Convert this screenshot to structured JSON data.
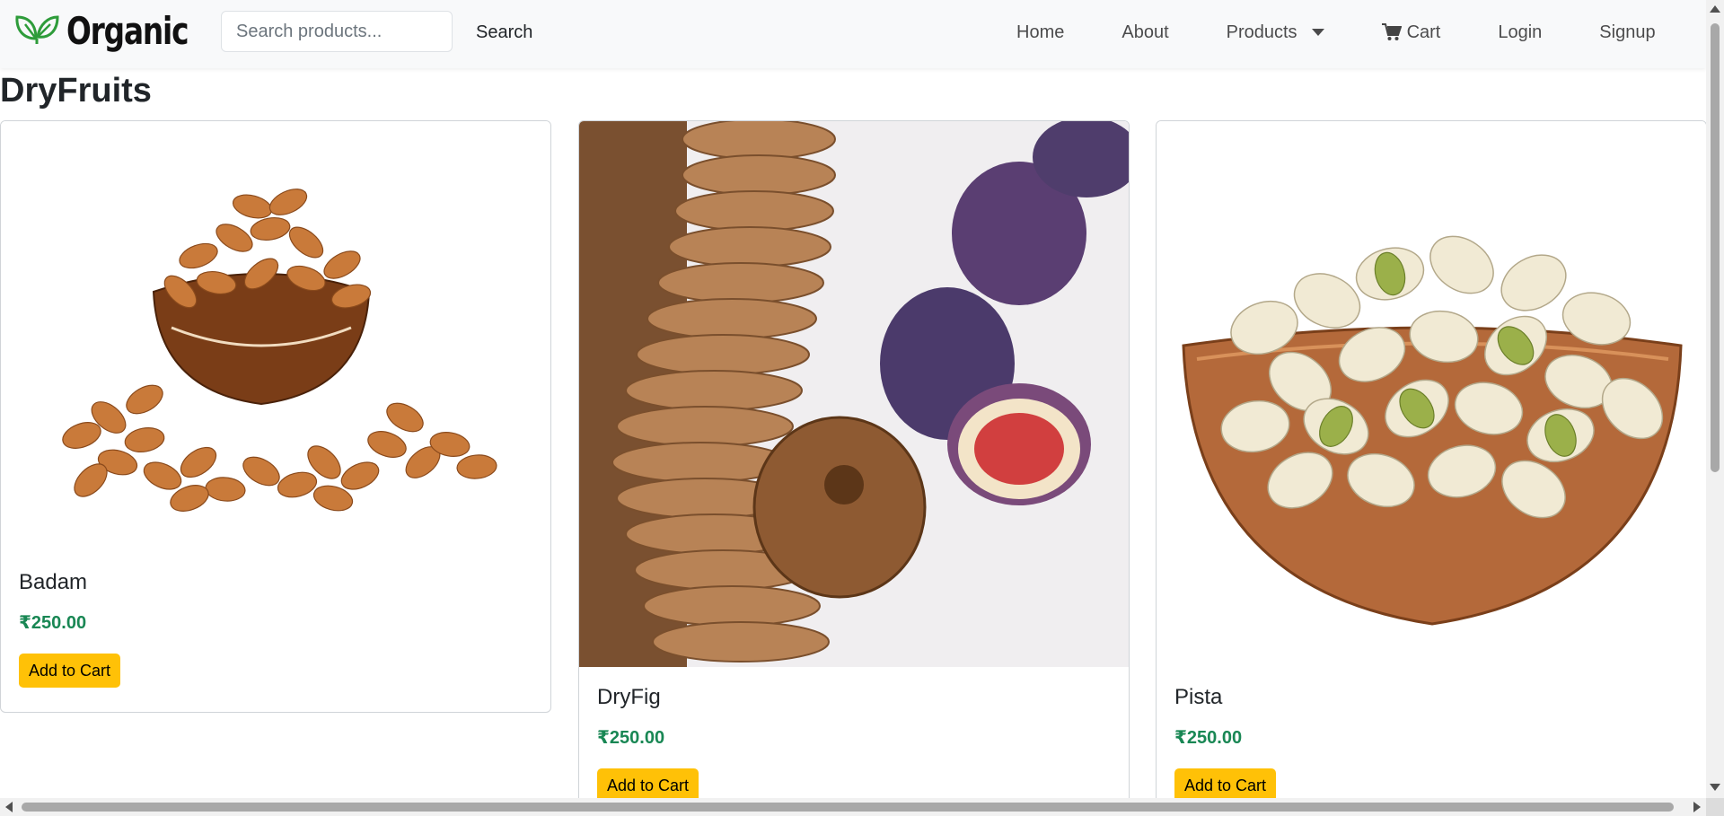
{
  "brand": {
    "name": "Organic",
    "icon": "leaf-icon"
  },
  "search": {
    "placeholder": "Search products...",
    "button_label": "Search"
  },
  "nav": {
    "home": "Home",
    "about": "About",
    "products": "Products",
    "cart": "Cart",
    "login": "Login",
    "signup": "Signup"
  },
  "page": {
    "title": "DryFruits"
  },
  "products": [
    {
      "name": "Badam",
      "price": "₹250.00",
      "button": "Add to Cart",
      "image": "almonds-image"
    },
    {
      "name": "DryFig",
      "price": "₹250.00",
      "button": "Add to Cart",
      "image": "dried-figs-image"
    },
    {
      "name": "Pista",
      "price": "₹250.00",
      "button": "Add to Cart",
      "image": "pistachios-image"
    }
  ],
  "colors": {
    "accent_yellow": "#ffc107",
    "price_green": "#198754",
    "navbar_bg": "#f8f9fa",
    "brand_leaf": "#2e9c3a"
  }
}
